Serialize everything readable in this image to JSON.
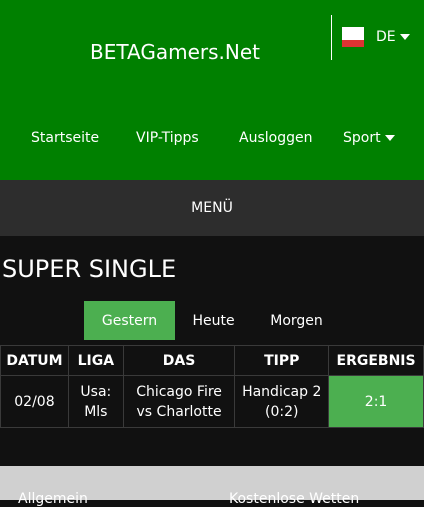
{
  "header": {
    "site_title": "BETAGamers.Net",
    "language": "DE",
    "flag_colors": [
      "#ffffff",
      "#ffffff",
      "#dd3333"
    ],
    "bg_color": "#008000"
  },
  "nav": {
    "items": [
      {
        "label": "Startseite"
      },
      {
        "label": "VIP-Tipps"
      },
      {
        "label": "Ausloggen"
      },
      {
        "label": "Sport"
      }
    ]
  },
  "menu": {
    "label": "MENÜ"
  },
  "section": {
    "title": "SUPER SINGLE"
  },
  "tabs": [
    {
      "label": "Gestern",
      "active": true
    },
    {
      "label": "Heute",
      "active": false
    },
    {
      "label": "Morgen",
      "active": false
    }
  ],
  "table": {
    "headers": [
      "DATUM",
      "LIGA",
      "DAS",
      "TIPP",
      "ERGEBNIS"
    ],
    "rows": [
      {
        "date": "02/08",
        "league_line1": "Usa:",
        "league_line2": "Mls",
        "match_line1": "Chicago Fire",
        "match_line2": "vs Charlotte",
        "tip_line1": "Handicap 2",
        "tip_line2": "(0:2)",
        "result": "2:1"
      }
    ]
  },
  "footer": {
    "links": [
      {
        "label": "Allgemein"
      },
      {
        "label": "Kostenlose Wetten"
      }
    ]
  },
  "colors": {
    "accent": "#4caf50",
    "header_green": "#008000",
    "menu_bar": "#2d2d2d",
    "background": "#111111"
  }
}
